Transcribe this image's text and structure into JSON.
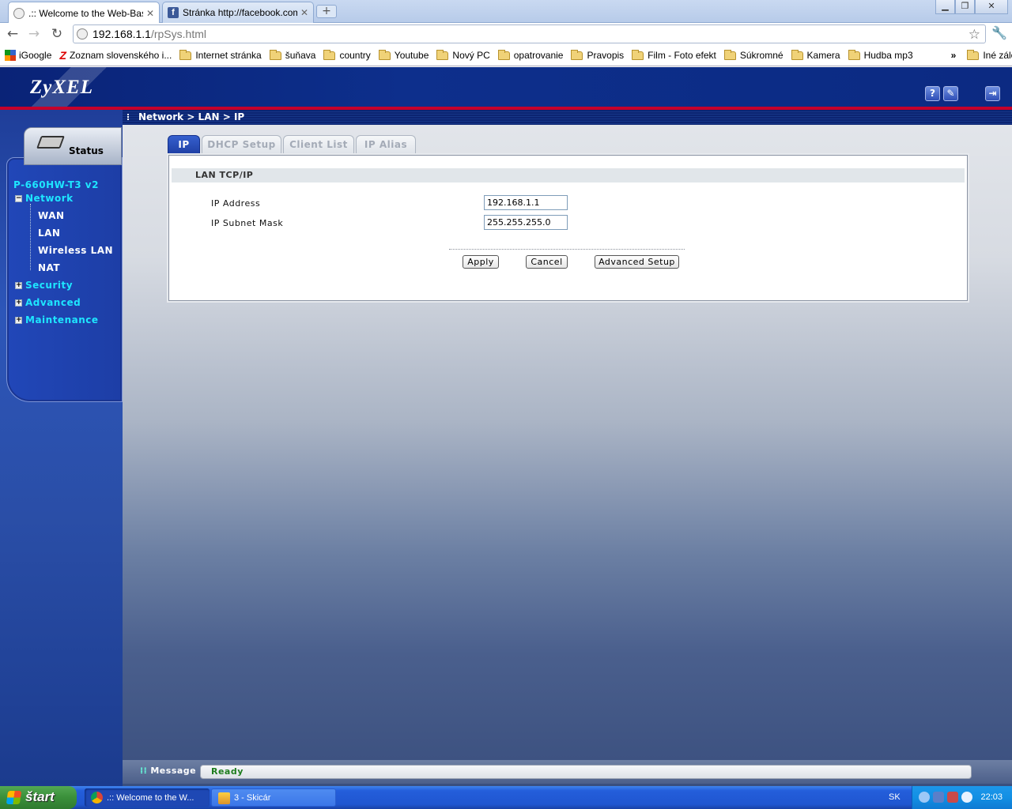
{
  "browser": {
    "tabs": [
      {
        "title": ".:: Welcome to the Web-Based",
        "active": true
      },
      {
        "title": "Stránka http://facebook.com/",
        "active": false
      }
    ],
    "new_tab": "+",
    "url_host": "192.168.1.1",
    "url_path": "/rpSys.html",
    "bookmarks": [
      {
        "label": "iGoogle",
        "icon": "igoogle-icon"
      },
      {
        "label": "Zoznam slovenského i...",
        "icon": "zoznam-icon"
      },
      {
        "label": "Internet stránka",
        "icon": "folder-icon"
      },
      {
        "label": "šuňava",
        "icon": "folder-icon"
      },
      {
        "label": "country",
        "icon": "folder-icon"
      },
      {
        "label": "Youtube",
        "icon": "folder-icon"
      },
      {
        "label": "Nový PC",
        "icon": "folder-icon"
      },
      {
        "label": "opatrovanie",
        "icon": "folder-icon"
      },
      {
        "label": "Pravopis",
        "icon": "folder-icon"
      },
      {
        "label": "Film - Foto efekt",
        "icon": "folder-icon"
      },
      {
        "label": "Súkromné",
        "icon": "folder-icon"
      },
      {
        "label": "Kamera",
        "icon": "folder-icon"
      },
      {
        "label": "Hudba mp3",
        "icon": "folder-icon"
      }
    ],
    "bookmarks_overflow": "»",
    "other_bookmarks": "Iné záložky"
  },
  "router": {
    "logo": "ZyXEL",
    "status_label": "Status",
    "model": "P-660HW-T3 v2",
    "nav": {
      "network": "Network",
      "wan": "WAN",
      "lan": "LAN",
      "wireless_lan": "Wireless LAN",
      "nat": "NAT",
      "security": "Security",
      "advanced": "Advanced",
      "maintenance": "Maintenance"
    },
    "breadcrumb": "Network > LAN > IP",
    "tabs": [
      "IP",
      "DHCP Setup",
      "Client List",
      "IP Alias"
    ],
    "section_title": "LAN TCP/IP",
    "fields": {
      "ip_label": "IP Address",
      "ip_value": "192.168.1.1",
      "mask_label": "IP Subnet Mask",
      "mask_value": "255.255.255.0"
    },
    "buttons": {
      "apply": "Apply",
      "cancel": "Cancel",
      "advanced_setup": "Advanced Setup"
    },
    "message_label": "Message",
    "message_value": "Ready"
  },
  "taskbar": {
    "start": "štart",
    "tasks": [
      {
        "label": ".:: Welcome to the W...",
        "pressed": true
      },
      {
        "label": "3 - Skicár",
        "pressed": false
      }
    ],
    "language": "SK",
    "clock": "22:03"
  },
  "colors": {
    "zyxel_blue": "#0d2f8c",
    "accent_red": "#c5002b",
    "nav_cyan": "#1ee6ff",
    "ready_green": "#1e7d1e"
  }
}
